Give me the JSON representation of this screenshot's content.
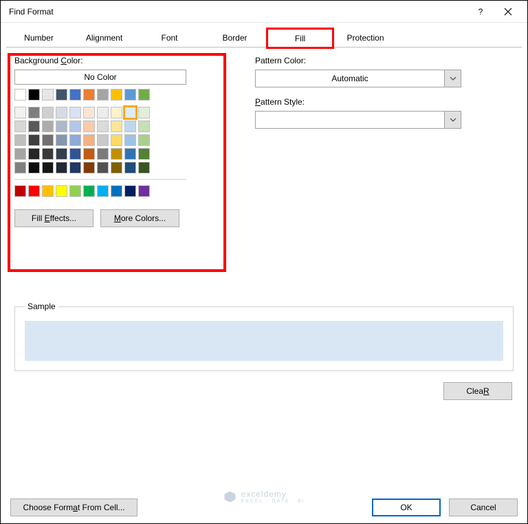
{
  "title": "Find Format",
  "tabs": [
    "Number",
    "Alignment",
    "Font",
    "Border",
    "Fill",
    "Protection"
  ],
  "activeTab": "Fill",
  "left": {
    "label_pre": "Background ",
    "label_u": "C",
    "label_post": "olor:",
    "nocolor": "No Color",
    "fill_effects_pre": "Fill ",
    "fill_effects_u": "E",
    "fill_effects_post": "ffects...",
    "more_colors_u": "M",
    "more_colors_post": "ore Colors...",
    "theme_row": [
      "#ffffff",
      "#000000",
      "#e7e6e6",
      "#44546a",
      "#4472c4",
      "#ed7d31",
      "#a5a5a5",
      "#ffc000",
      "#5b9bd5",
      "#70ad47"
    ],
    "shade_rows": [
      [
        "#f2f2f2",
        "#7f7f7f",
        "#d0cece",
        "#d6dce4",
        "#d9e2f3",
        "#fbe5d5",
        "#ededed",
        "#fff2cc",
        "#deebf6",
        "#e2efd9"
      ],
      [
        "#d8d8d8",
        "#595959",
        "#aeabab",
        "#adb9ca",
        "#b4c6e7",
        "#f7cbac",
        "#dbdbdb",
        "#fee599",
        "#bdd7ee",
        "#c5e0b3"
      ],
      [
        "#bfbfbf",
        "#3f3f3f",
        "#757070",
        "#8496b0",
        "#8eaadb",
        "#f4b183",
        "#c9c9c9",
        "#ffd965",
        "#9cc3e5",
        "#a8d08d"
      ],
      [
        "#a5a5a5",
        "#262626",
        "#3a3838",
        "#323f4f",
        "#2f5496",
        "#c55a11",
        "#7b7b7b",
        "#bf9000",
        "#2e75b5",
        "#538135"
      ],
      [
        "#7f7f7f",
        "#0c0c0c",
        "#171616",
        "#222a35",
        "#1f3864",
        "#833c0b",
        "#525252",
        "#7f6000",
        "#1e4e79",
        "#375623"
      ]
    ],
    "standard_row": [
      "#c00000",
      "#ff0000",
      "#ffc000",
      "#ffff00",
      "#92d050",
      "#00b050",
      "#00b0f0",
      "#0070c0",
      "#002060",
      "#7030a0"
    ],
    "selected": {
      "row": 0,
      "col": 8,
      "group": "shade"
    }
  },
  "right": {
    "pattern_color_u": "A",
    "pattern_color_pre": "Pattern Color:",
    "pattern_color_value": "Automatic",
    "pattern_style_u": "P",
    "pattern_style_pre": "Pattern Style:",
    "pattern_style_value": ""
  },
  "sample": {
    "label": "Sample",
    "color": "#d9e7f5"
  },
  "buttons": {
    "clear_u": "R",
    "clear_pre": "Clea",
    "choose_pre": "Choose Form",
    "choose_u": "a",
    "choose_post": "t From Cell...",
    "ok": "OK",
    "cancel": "Cancel"
  },
  "watermark": {
    "main": "exceldemy",
    "sub": "EXCEL · DATA · BI"
  }
}
